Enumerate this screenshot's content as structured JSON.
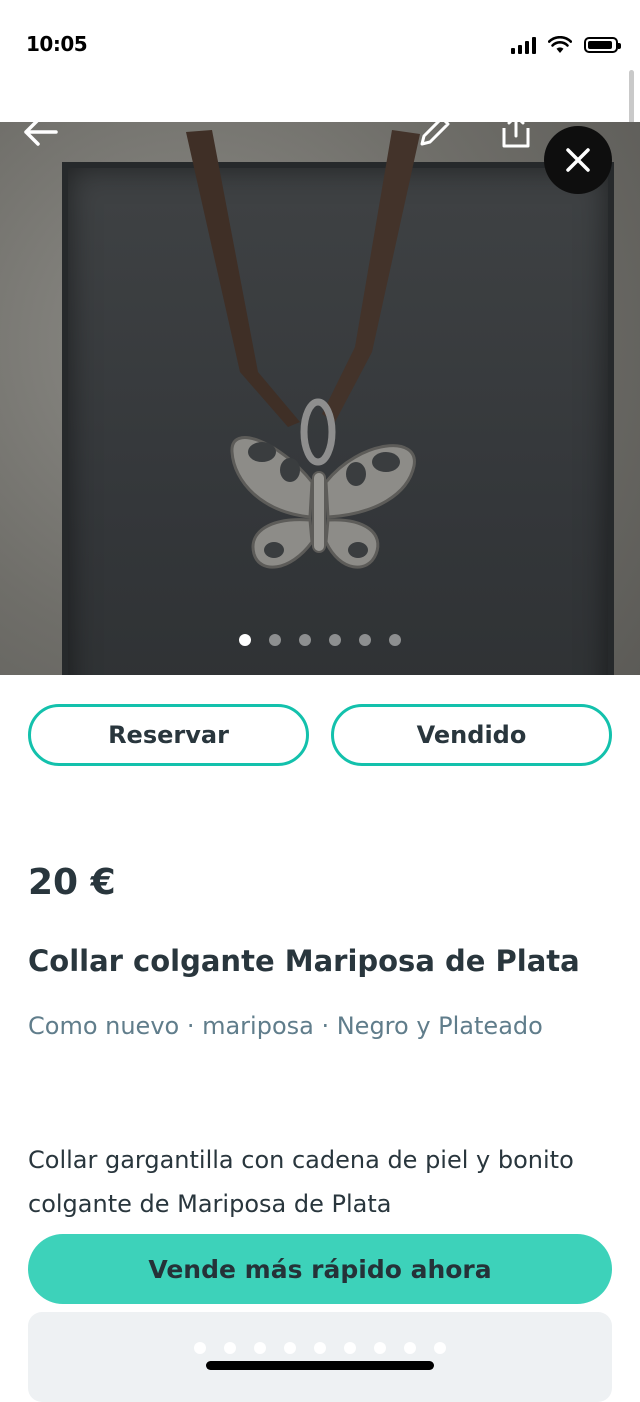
{
  "status_bar": {
    "time": "10:05"
  },
  "gallery": {
    "image_count": 6,
    "active_index": 0,
    "icons": {
      "back": "arrow-left-icon",
      "edit": "pencil-icon",
      "share": "share-icon",
      "close": "close-icon"
    }
  },
  "actions": {
    "reserve_label": "Reservar",
    "sold_label": "Vendido"
  },
  "item": {
    "price": "20 €",
    "title": "Collar colgante Mariposa de Plata",
    "meta": "Como nuevo · mariposa · Negro y Plateado",
    "description": "Collar gargantilla con cadena de piel y bonito colgante de Mariposa de Plata"
  },
  "cta": {
    "label": "Vende más rápido ahora"
  },
  "promo_carousel": {
    "page_count": 9
  },
  "colors": {
    "accent": "#13c1ac",
    "cta_background": "#3dd2ba",
    "text_primary": "#29363d",
    "text_secondary": "#607d8b"
  }
}
